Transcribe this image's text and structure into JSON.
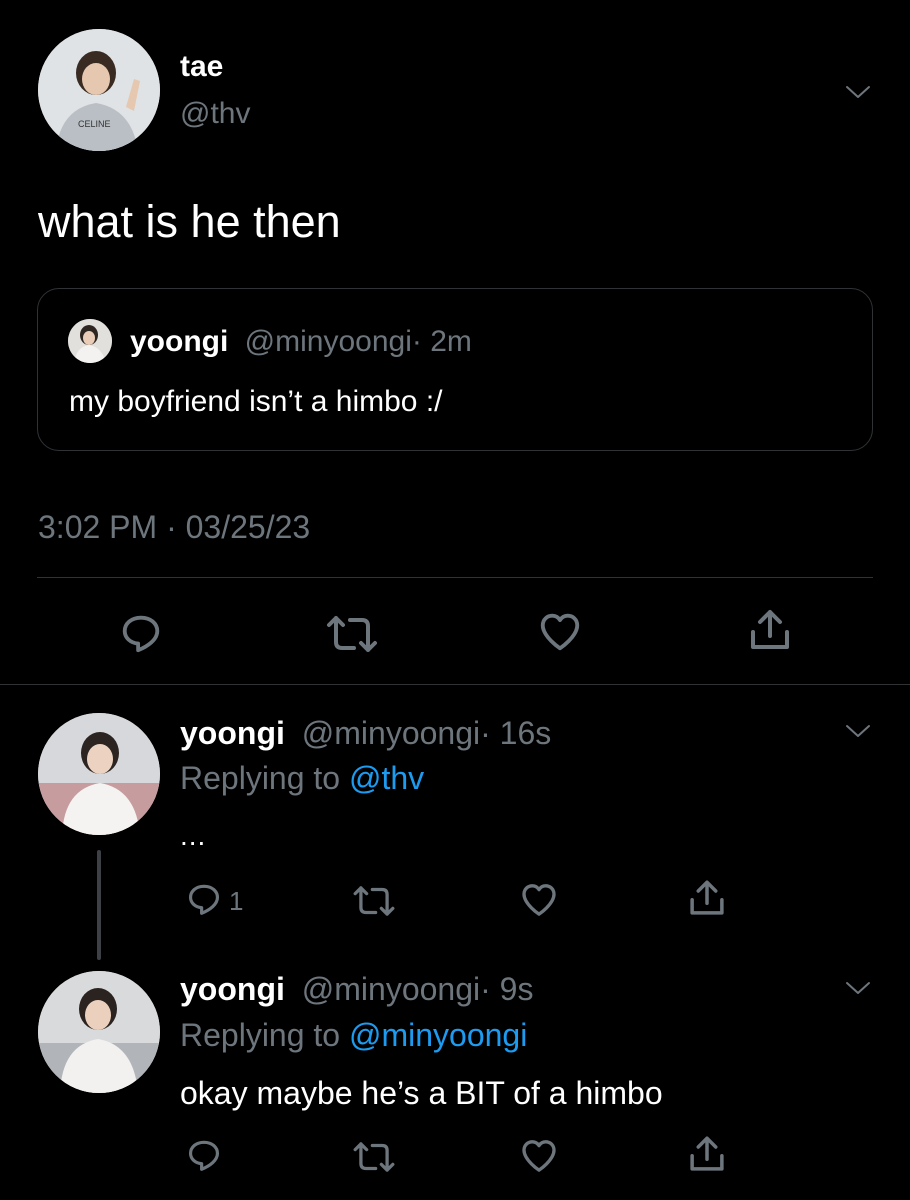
{
  "main_tweet": {
    "display_name": "tae",
    "handle": "@thv",
    "avatar_shirt_text": "CELINE",
    "text": "what is he then",
    "quote": {
      "display_name": "yoongi",
      "handle": "@minyoongi",
      "time": "· 2m",
      "text": "my boyfriend isn’t a himbo :/"
    },
    "timestamp": "3:02 PM · 03/25/23"
  },
  "replies": [
    {
      "display_name": "yoongi",
      "handle": "@minyoongi",
      "time": "· 16s",
      "replying_prefix": "Replying to",
      "replying_to": "@thv",
      "text": "...",
      "reply_count": "1"
    },
    {
      "display_name": "yoongi",
      "handle": "@minyoongi",
      "time": "· 9s",
      "replying_prefix": "Replying to",
      "replying_to": "@minyoongi",
      "text": "okay maybe he’s a BIT of a himbo",
      "reply_count": ""
    }
  ],
  "icons": {
    "reply": "reply-icon",
    "retweet": "retweet-icon",
    "like": "heart-icon",
    "share": "share-icon",
    "more": "chevron-down-icon"
  },
  "colors": {
    "background": "#000000",
    "text": "#ffffff",
    "secondary": "#6e767d",
    "link": "#1d9bf0",
    "border": "#2f3336"
  }
}
